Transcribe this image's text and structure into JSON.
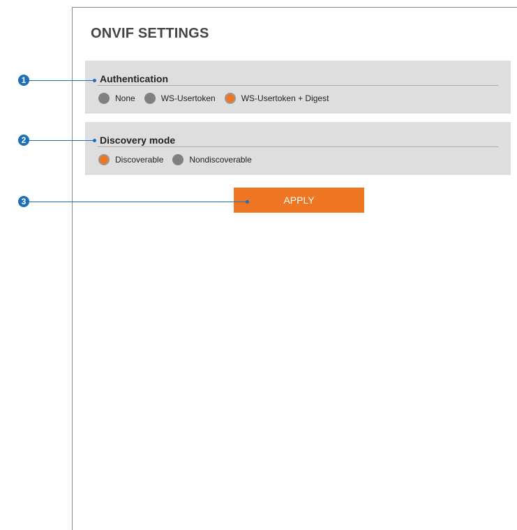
{
  "page": {
    "title": "ONVIF SETTINGS"
  },
  "authentication": {
    "title": "Authentication",
    "options": [
      {
        "label": "None",
        "checked": false
      },
      {
        "label": "WS-Usertoken",
        "checked": false
      },
      {
        "label": "WS-Usertoken + Digest",
        "checked": true
      }
    ]
  },
  "discovery": {
    "title": "Discovery mode",
    "options": [
      {
        "label": "Discoverable",
        "checked": true
      },
      {
        "label": "Nondiscoverable",
        "checked": false
      }
    ]
  },
  "apply": {
    "label": "APPLY"
  },
  "callouts": [
    "1",
    "2",
    "3"
  ],
  "colors": {
    "accent": "#ee7522",
    "panel": "#dedede",
    "radio_off": "#808080",
    "callout": "#1d6fb8"
  }
}
